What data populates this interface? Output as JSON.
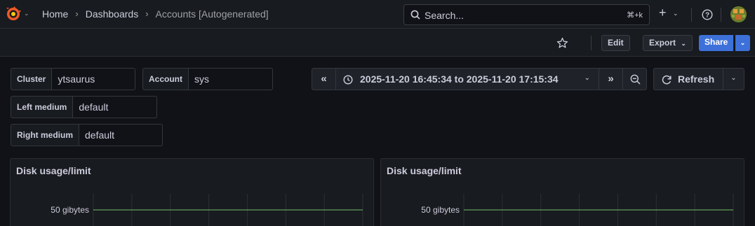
{
  "breadcrumbs": [
    {
      "label": "Home"
    },
    {
      "label": "Dashboards"
    },
    {
      "label": "Accounts [Autogenerated]"
    }
  ],
  "search": {
    "placeholder": "Search...",
    "shortcut": "⌘+k"
  },
  "toolbar": {
    "edit_label": "Edit",
    "export_label": "Export",
    "share_label": "Share"
  },
  "variables": [
    {
      "label": "Cluster",
      "value": "ytsaurus"
    },
    {
      "label": "Account",
      "value": "sys"
    },
    {
      "label": "Left medium",
      "value": "default"
    },
    {
      "label": "Right medium",
      "value": "default"
    }
  ],
  "time_picker": {
    "range": "2025-11-20 16:45:34 to 2025-11-20 17:15:34"
  },
  "refresh": {
    "label": "Refresh"
  },
  "colors": {
    "accent": "#3d71d9",
    "series": "#73bf69",
    "background": "#111217",
    "panel": "#181b1f"
  },
  "panels": [
    {
      "title": "Disk usage/limit",
      "ytick": "50 gibytes"
    },
    {
      "title": "Disk usage/limit",
      "ytick": "50 gibytes"
    }
  ],
  "chart_data": [
    {
      "type": "line",
      "title": "Disk usage/limit",
      "yticks": [
        "50 gibytes"
      ],
      "grid": true,
      "series": []
    },
    {
      "type": "line",
      "title": "Disk usage/limit",
      "yticks": [
        "50 gibytes"
      ],
      "grid": true,
      "series": []
    }
  ]
}
